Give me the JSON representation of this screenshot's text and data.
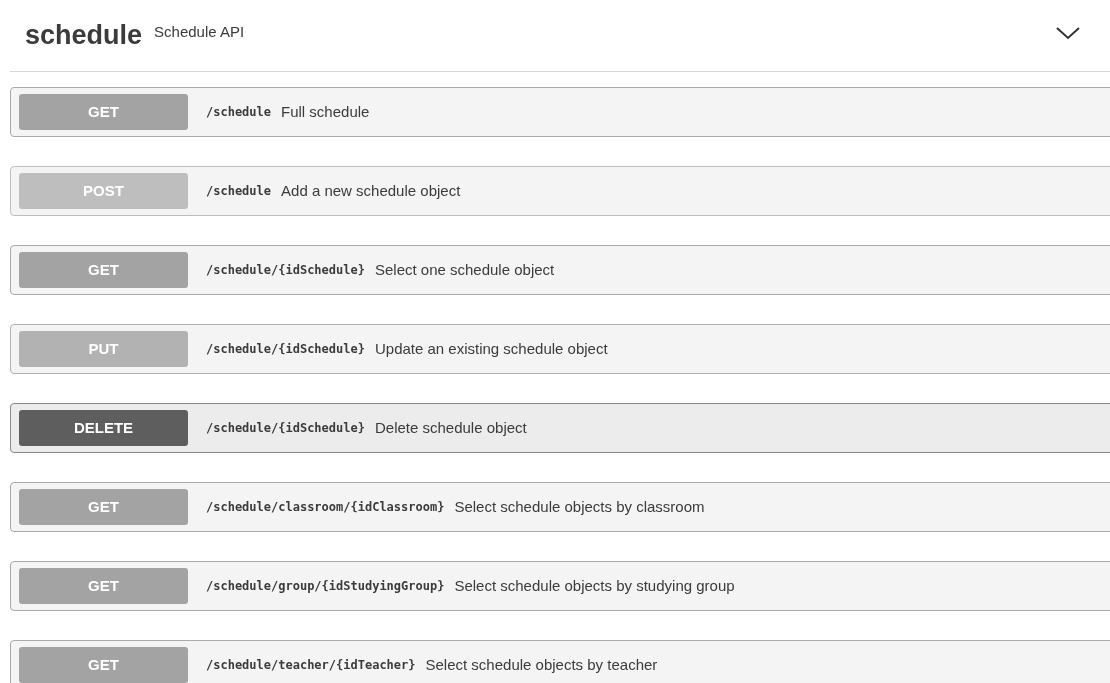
{
  "section": {
    "name": "schedule",
    "description": "Schedule API",
    "expanded": true
  },
  "operations": [
    {
      "method": "GET",
      "path": "/schedule",
      "summary": "Full schedule"
    },
    {
      "method": "POST",
      "path": "/schedule",
      "summary": "Add a new schedule object"
    },
    {
      "method": "GET",
      "path": "/schedule/{idSchedule}",
      "summary": "Select one schedule object"
    },
    {
      "method": "PUT",
      "path": "/schedule/{idSchedule}",
      "summary": "Update an existing schedule object"
    },
    {
      "method": "DELETE",
      "path": "/schedule/{idSchedule}",
      "summary": "Delete schedule object"
    },
    {
      "method": "GET",
      "path": "/schedule/classroom/{idClassroom}",
      "summary": "Select schedule objects by classroom"
    },
    {
      "method": "GET",
      "path": "/schedule/group/{idStudyingGroup}",
      "summary": "Select schedule objects by studying group"
    },
    {
      "method": "GET",
      "path": "/schedule/teacher/{idTeacher}",
      "summary": "Select schedule objects by teacher"
    }
  ]
}
